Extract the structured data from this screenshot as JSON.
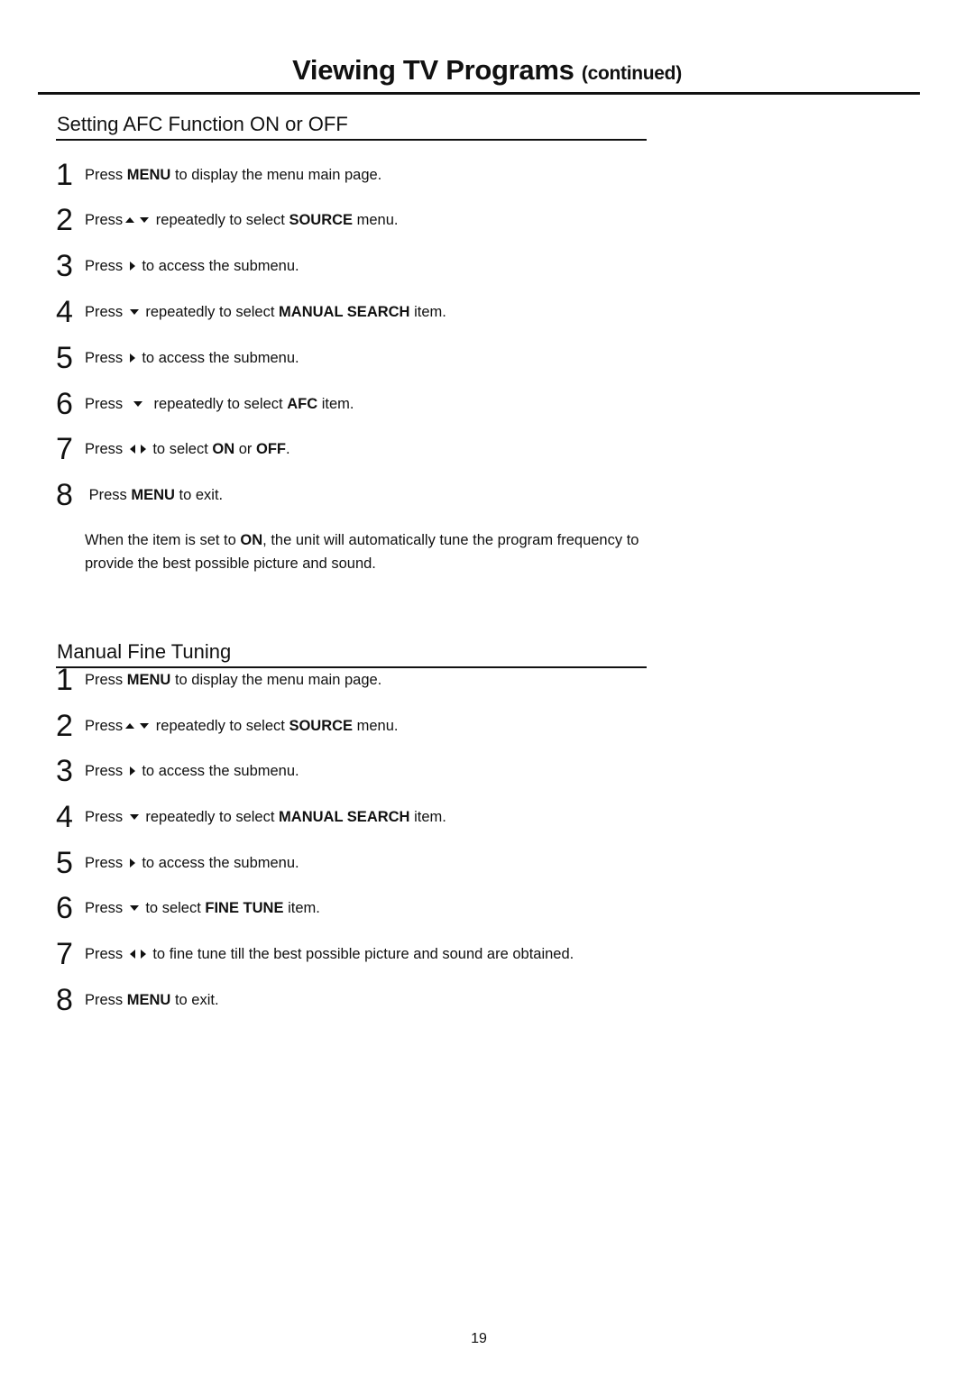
{
  "header": {
    "title": "Viewing TV Programs",
    "subtitle": "(continued)"
  },
  "sections": [
    {
      "title": "Setting AFC Function ON or OFF",
      "steps": [
        {
          "num": "1",
          "parts": [
            {
              "t": "text",
              "v": "Press "
            },
            {
              "t": "bold",
              "v": "MENU"
            },
            {
              "t": "text",
              "v": " to display the menu main page."
            }
          ]
        },
        {
          "num": "2",
          "parts": [
            {
              "t": "text",
              "v": "Press"
            },
            {
              "t": "icon",
              "v": "up"
            },
            {
              "t": "icon",
              "v": "down"
            },
            {
              "t": "text",
              "v": " repeatedly to select "
            },
            {
              "t": "bold",
              "v": "SOURCE"
            },
            {
              "t": "text",
              "v": " menu."
            }
          ]
        },
        {
          "num": "3",
          "parts": [
            {
              "t": "text",
              "v": "Press "
            },
            {
              "t": "icon",
              "v": "right"
            },
            {
              "t": "text",
              "v": " to access the submenu."
            }
          ]
        },
        {
          "num": "4",
          "parts": [
            {
              "t": "text",
              "v": "Press "
            },
            {
              "t": "icon",
              "v": "down"
            },
            {
              "t": "text",
              "v": " repeatedly to select "
            },
            {
              "t": "bold",
              "v": "MANUAL SEARCH"
            },
            {
              "t": "text",
              "v": " item."
            }
          ]
        },
        {
          "num": "5",
          "parts": [
            {
              "t": "text",
              "v": "Press "
            },
            {
              "t": "icon",
              "v": "right"
            },
            {
              "t": "text",
              "v": " to access the submenu."
            }
          ]
        },
        {
          "num": "6",
          "parts": [
            {
              "t": "text",
              "v": "Press  "
            },
            {
              "t": "icon",
              "v": "down"
            },
            {
              "t": "text",
              "v": "  repeatedly to select "
            },
            {
              "t": "bold",
              "v": "AFC"
            },
            {
              "t": "text",
              "v": " item."
            }
          ]
        },
        {
          "num": "7",
          "parts": [
            {
              "t": "text",
              "v": "Press "
            },
            {
              "t": "icon",
              "v": "left"
            },
            {
              "t": "icon",
              "v": "right"
            },
            {
              "t": "text",
              "v": " to select "
            },
            {
              "t": "bold",
              "v": "ON"
            },
            {
              "t": "text",
              "v": " or "
            },
            {
              "t": "bold",
              "v": "OFF"
            },
            {
              "t": "text",
              "v": "."
            }
          ]
        },
        {
          "num": "8",
          "parts": [
            {
              "t": "text",
              "v": " Press "
            },
            {
              "t": "bold",
              "v": "MENU"
            },
            {
              "t": "text",
              "v": " to exit."
            }
          ]
        }
      ],
      "note": [
        {
          "t": "text",
          "v": "When the item is set to "
        },
        {
          "t": "bold",
          "v": "ON"
        },
        {
          "t": "text",
          "v": ", the unit will automatically tune the program frequency to provide the best possible picture and sound."
        }
      ]
    },
    {
      "title": "Manual Fine Tuning",
      "steps": [
        {
          "num": "1",
          "parts": [
            {
              "t": "text",
              "v": "Press "
            },
            {
              "t": "bold",
              "v": "MENU"
            },
            {
              "t": "text",
              "v": " to display the menu main page."
            }
          ]
        },
        {
          "num": "2",
          "parts": [
            {
              "t": "text",
              "v": "Press"
            },
            {
              "t": "icon",
              "v": "up"
            },
            {
              "t": "icon",
              "v": "down"
            },
            {
              "t": "text",
              "v": " repeatedly to select "
            },
            {
              "t": "bold",
              "v": "SOURCE"
            },
            {
              "t": "text",
              "v": " menu."
            }
          ]
        },
        {
          "num": "3",
          "parts": [
            {
              "t": "text",
              "v": "Press "
            },
            {
              "t": "icon",
              "v": "right"
            },
            {
              "t": "text",
              "v": " to access the submenu."
            }
          ]
        },
        {
          "num": "4",
          "parts": [
            {
              "t": "text",
              "v": "Press "
            },
            {
              "t": "icon",
              "v": "down"
            },
            {
              "t": "text",
              "v": " repeatedly to select "
            },
            {
              "t": "bold",
              "v": "MANUAL SEARCH"
            },
            {
              "t": "text",
              "v": " item."
            }
          ]
        },
        {
          "num": "5",
          "parts": [
            {
              "t": "text",
              "v": "Press "
            },
            {
              "t": "icon",
              "v": "right"
            },
            {
              "t": "text",
              "v": " to access the submenu."
            }
          ]
        },
        {
          "num": "6",
          "parts": [
            {
              "t": "text",
              "v": "Press "
            },
            {
              "t": "icon",
              "v": "down"
            },
            {
              "t": "text",
              "v": " to select "
            },
            {
              "t": "bold",
              "v": "FINE TUNE"
            },
            {
              "t": "text",
              "v": " item."
            }
          ]
        },
        {
          "num": "7",
          "parts": [
            {
              "t": "text",
              "v": "Press "
            },
            {
              "t": "icon",
              "v": "left"
            },
            {
              "t": "icon",
              "v": "right"
            },
            {
              "t": "text",
              "v": " to fine tune till the best possible picture and sound are obtained."
            }
          ]
        },
        {
          "num": "8",
          "parts": [
            {
              "t": "text",
              "v": "Press "
            },
            {
              "t": "bold",
              "v": "MENU"
            },
            {
              "t": "text",
              "v": " to exit."
            }
          ]
        }
      ],
      "note": []
    }
  ],
  "icons": {
    "up": "up-arrow-icon",
    "down": "down-arrow-icon",
    "left": "left-arrow-icon",
    "right": "right-arrow-icon"
  },
  "footer": {
    "page_number": "19"
  }
}
